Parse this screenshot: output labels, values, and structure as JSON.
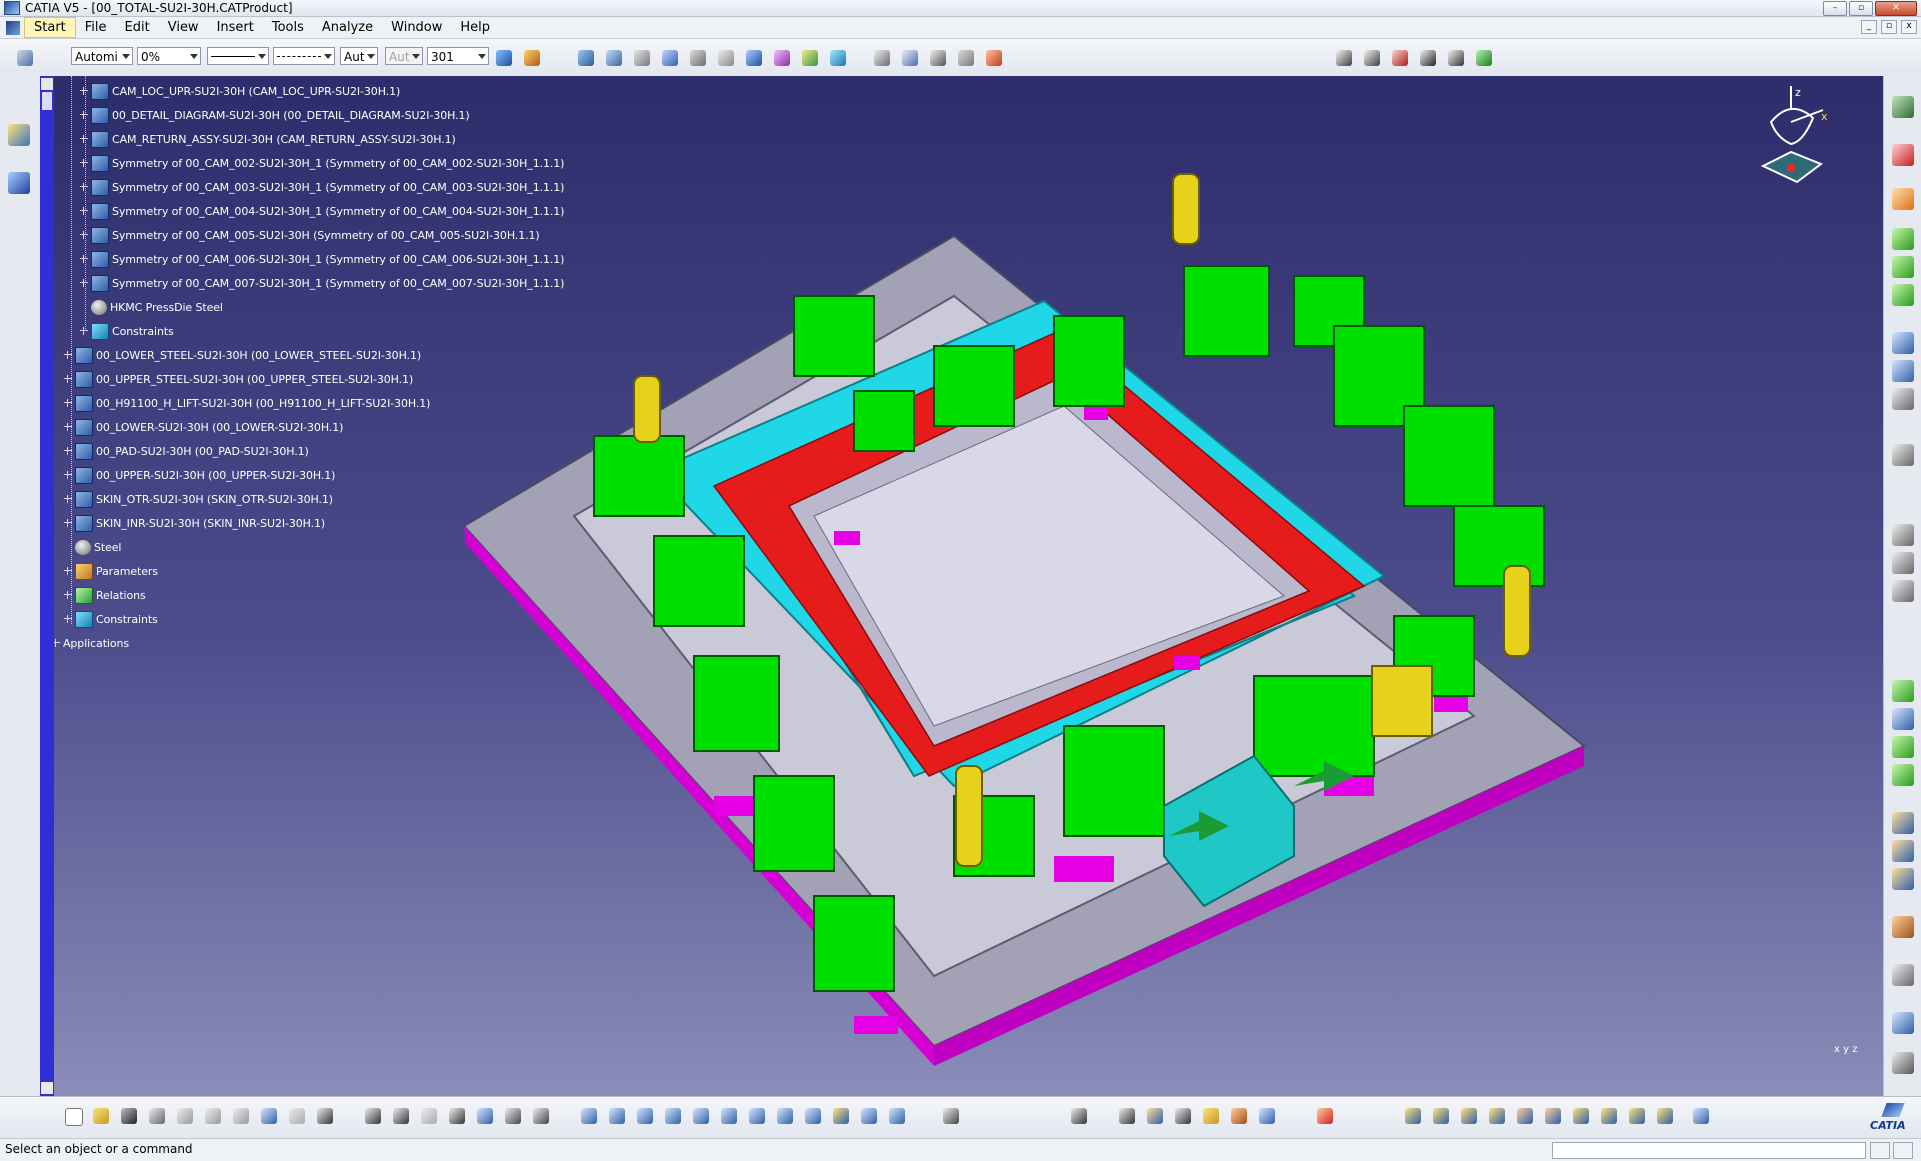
{
  "window": {
    "title": "CATIA V5 - [00_TOTAL-SU2I-30H.CATProduct]",
    "buttons": {
      "minimize": "–",
      "maximize": "▫",
      "close": "✕"
    }
  },
  "menubar": {
    "items": [
      "Start",
      "File",
      "Edit",
      "View",
      "Insert",
      "Tools",
      "Analyze",
      "Window",
      "Help"
    ],
    "active_item": "Start",
    "mdi_buttons": {
      "minimize": "_",
      "restore": "▫",
      "close": "x"
    }
  },
  "toolbar": {
    "layer_value": "Automi",
    "transparency_value": "0%",
    "line_weight_value": "Aut",
    "point_value": "Aut",
    "layer_number_value": "301"
  },
  "tree": {
    "items": [
      {
        "label": "CAM_LOC_UPR-SU2I-30H (CAM_LOC_UPR-SU2I-30H.1)",
        "icon": "product-icon"
      },
      {
        "label": "00_DETAIL_DIAGRAM-SU2I-30H (00_DETAIL_DIAGRAM-SU2I-30H.1)",
        "icon": "product-icon"
      },
      {
        "label": "CAM_RETURN_ASSY-SU2I-30H (CAM_RETURN_ASSY-SU2I-30H.1)",
        "icon": "product-icon"
      },
      {
        "label": "Symmetry of 00_CAM_002-SU2I-30H_1 (Symmetry of 00_CAM_002-SU2I-30H_1.1.1)",
        "icon": "product-icon"
      },
      {
        "label": "Symmetry of 00_CAM_003-SU2I-30H_1 (Symmetry of 00_CAM_003-SU2I-30H_1.1.1)",
        "icon": "product-icon"
      },
      {
        "label": "Symmetry of 00_CAM_004-SU2I-30H_1 (Symmetry of 00_CAM_004-SU2I-30H_1.1.1)",
        "icon": "product-icon"
      },
      {
        "label": "Symmetry of 00_CAM_005-SU2I-30H (Symmetry of 00_CAM_005-SU2I-30H.1.1)",
        "icon": "product-icon"
      },
      {
        "label": "Symmetry of 00_CAM_006-SU2I-30H_1 (Symmetry of 00_CAM_006-SU2I-30H_1.1.1)",
        "icon": "product-icon"
      },
      {
        "label": "Symmetry of 00_CAM_007-SU2I-30H_1 (Symmetry of 00_CAM_007-SU2I-30H_1.1.1)",
        "icon": "product-icon"
      },
      {
        "label": "HKMC PressDie Steel",
        "icon": "material-icon"
      },
      {
        "label": "Constraints",
        "icon": "constraints-icon"
      },
      {
        "label": "00_LOWER_STEEL-SU2I-30H (00_LOWER_STEEL-SU2I-30H.1)",
        "icon": "product-icon"
      },
      {
        "label": "00_UPPER_STEEL-SU2I-30H (00_UPPER_STEEL-SU2I-30H.1)",
        "icon": "product-icon"
      },
      {
        "label": "00_H91100_H_LIFT-SU2I-30H (00_H91100_H_LIFT-SU2I-30H.1)",
        "icon": "product-icon"
      },
      {
        "label": "00_LOWER-SU2I-30H (00_LOWER-SU2I-30H.1)",
        "icon": "product-icon"
      },
      {
        "label": "00_PAD-SU2I-30H (00_PAD-SU2I-30H.1)",
        "icon": "product-icon"
      },
      {
        "label": "00_UPPER-SU2I-30H (00_UPPER-SU2I-30H.1)",
        "icon": "product-icon"
      },
      {
        "label": "SKIN_OTR-SU2I-30H (SKIN_OTR-SU2I-30H.1)",
        "icon": "product-icon"
      },
      {
        "label": "SKIN_INR-SU2I-30H (SKIN_INR-SU2I-30H.1)",
        "icon": "product-icon"
      },
      {
        "label": "Steel",
        "icon": "material-icon"
      },
      {
        "label": "Parameters",
        "icon": "parameters-icon"
      },
      {
        "label": "Relations",
        "icon": "relations-icon"
      },
      {
        "label": "Constraints",
        "icon": "constraints-icon"
      },
      {
        "label": "Applications",
        "icon": "applications-icon"
      }
    ]
  },
  "compass": {
    "z_label": "z",
    "x_label": "x"
  },
  "viewport": {
    "axis_label": "x y z"
  },
  "catia_logo": "CATIA",
  "status": {
    "message": "Select an object or a command"
  },
  "colors": {
    "background_top": "#2d2d6c",
    "background_bottom": "#8a8db8",
    "part_green": "#00e000",
    "part_cyan": "#1fd7e6",
    "part_red": "#e61b1b",
    "part_magenta": "#e600e6",
    "part_yellow": "#e6d21a",
    "part_gray": "#c9c9d8"
  }
}
